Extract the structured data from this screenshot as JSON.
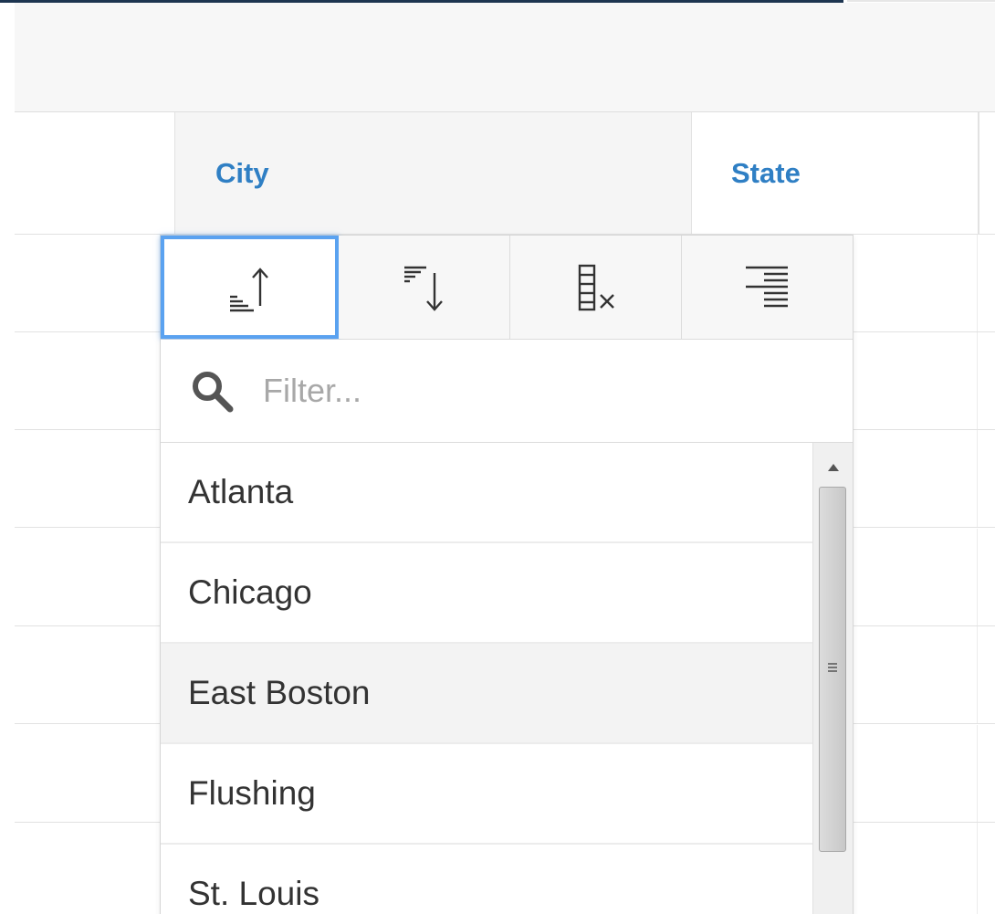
{
  "grid": {
    "columns": [
      {
        "key": "city",
        "label": "City"
      },
      {
        "key": "state",
        "label": "State"
      }
    ]
  },
  "column_menu": {
    "actions": [
      {
        "name": "sort-ascending",
        "icon": "sort-ascending-icon",
        "active": true
      },
      {
        "name": "sort-descending",
        "icon": "sort-descending-icon",
        "active": false
      },
      {
        "name": "clear-column",
        "icon": "clear-column-icon",
        "active": false
      },
      {
        "name": "align-right",
        "icon": "align-right-icon",
        "active": false
      }
    ],
    "filter": {
      "placeholder": "Filter...",
      "value": ""
    },
    "items": [
      {
        "label": "Atlanta"
      },
      {
        "label": "Chicago"
      },
      {
        "label": "East Boston"
      },
      {
        "label": "Flushing"
      },
      {
        "label": "St. Louis"
      }
    ],
    "hovered_item": "East Boston"
  },
  "colors": {
    "accent": "#2f7fc4",
    "focus": "#5aa2f0",
    "top_bar": "#1d3550"
  }
}
